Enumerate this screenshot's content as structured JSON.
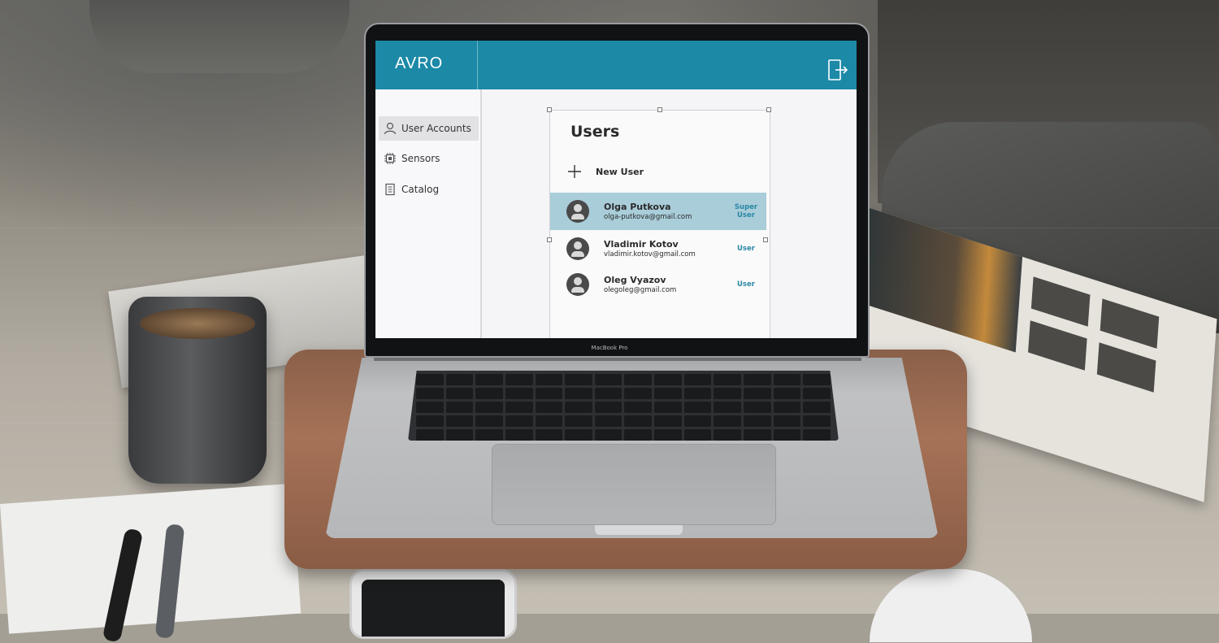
{
  "device": {
    "model_label": "MacBook Pro"
  },
  "app": {
    "logo": "AVRO",
    "accent_color": "#1c89a7",
    "header": {
      "logout_icon": "logout-icon"
    }
  },
  "sidebar": {
    "items": [
      {
        "label": "User Accounts",
        "icon": "user-icon",
        "active": true
      },
      {
        "label": "Sensors",
        "icon": "chip-icon",
        "active": false
      },
      {
        "label": "Catalog",
        "icon": "catalog-icon",
        "active": false
      }
    ]
  },
  "users_panel": {
    "title": "Users",
    "new_user_label": "New User",
    "users": [
      {
        "name": "Olga Putkova",
        "email": "olga-putkova@gmail.com",
        "role_line1": "Super",
        "role_line2": "User",
        "selected": true
      },
      {
        "name": "Vladimir Kotov",
        "email": "vladimir.kotov@gmail.com",
        "role_line1": "User",
        "role_line2": "",
        "selected": false
      },
      {
        "name": "Oleg Vyazov",
        "email": "olegoleg@gmail.com",
        "role_line1": "User",
        "role_line2": "",
        "selected": false
      }
    ]
  }
}
